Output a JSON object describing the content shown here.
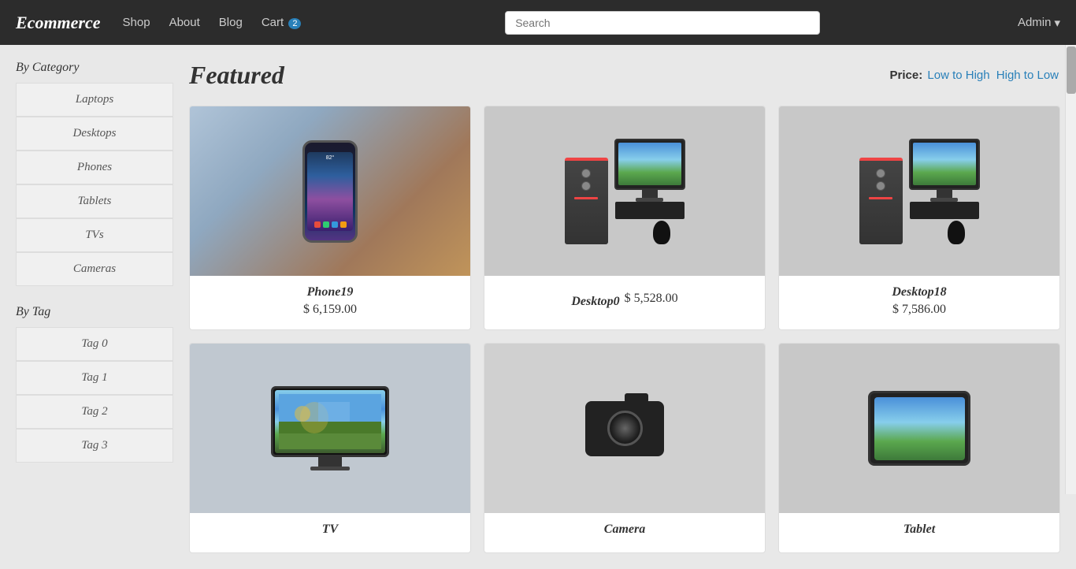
{
  "navbar": {
    "brand": "Ecommerce",
    "links": [
      {
        "label": "Shop",
        "href": "#"
      },
      {
        "label": "About",
        "href": "#"
      },
      {
        "label": "Blog",
        "href": "#"
      },
      {
        "label": "Cart",
        "href": "#",
        "badge": "2"
      }
    ],
    "search_placeholder": "Search",
    "admin_label": "Admin"
  },
  "sidebar": {
    "by_category_label": "By Category",
    "categories": [
      {
        "label": "Laptops"
      },
      {
        "label": "Desktops"
      },
      {
        "label": "Phones"
      },
      {
        "label": "Tablets"
      },
      {
        "label": "TVs"
      },
      {
        "label": "Cameras"
      }
    ],
    "by_tag_label": "By Tag",
    "tags": [
      {
        "label": "Tag 0"
      },
      {
        "label": "Tag 1"
      },
      {
        "label": "Tag 2"
      },
      {
        "label": "Tag 3"
      }
    ]
  },
  "main": {
    "featured_title": "Featured",
    "price_label": "Price:",
    "price_low_to_high": "Low to High",
    "price_high_to_low": "High to Low",
    "products": [
      {
        "name": "Phone19",
        "price": "$ 6,159.00",
        "type": "phone"
      },
      {
        "name": "Desktop0",
        "price": "$ 5,528.00",
        "type": "desktop"
      },
      {
        "name": "Desktop18",
        "price": "$ 7,586.00",
        "type": "desktop2"
      },
      {
        "name": "TV",
        "price": "",
        "type": "tv"
      },
      {
        "name": "Camera",
        "price": "",
        "type": "camera"
      },
      {
        "name": "Tablet",
        "price": "",
        "type": "tablet"
      }
    ]
  }
}
